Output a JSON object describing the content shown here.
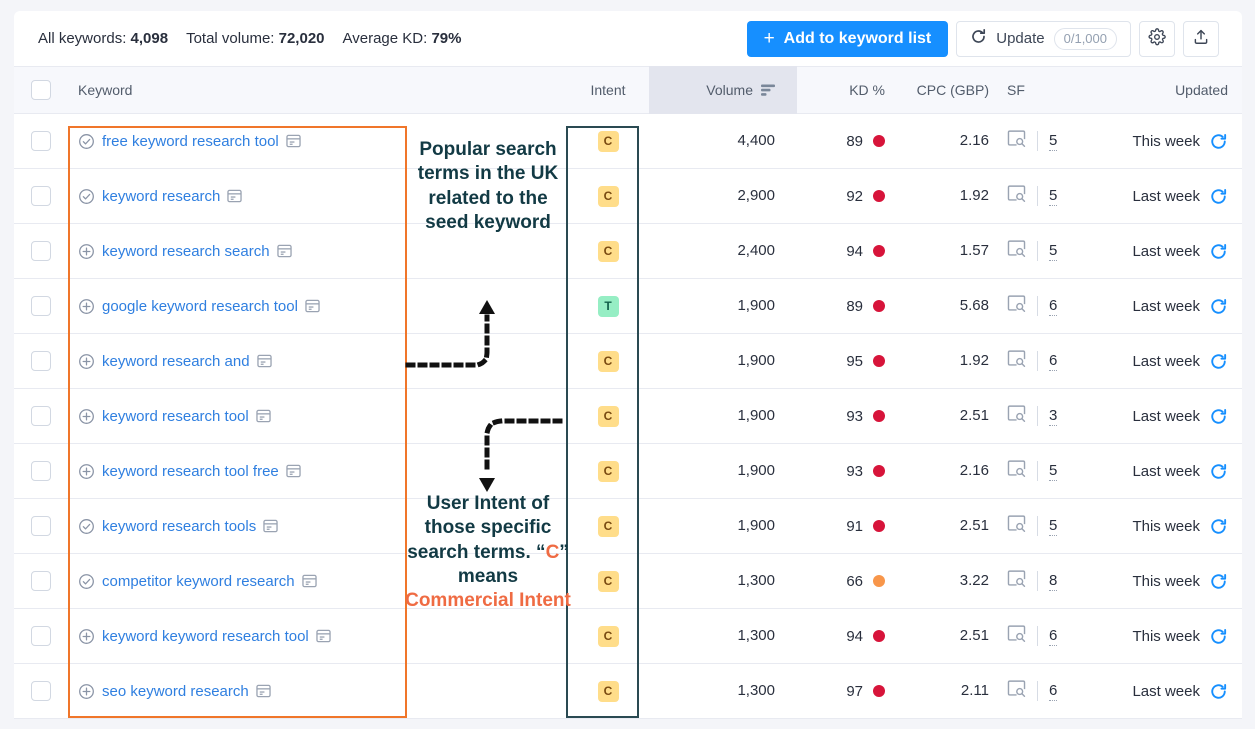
{
  "summary": {
    "all_keywords_label": "All keywords:",
    "all_keywords_value": "4,098",
    "total_volume_label": "Total volume:",
    "total_volume_value": "72,020",
    "average_kd_label": "Average KD:",
    "average_kd_value": "79%"
  },
  "toolbar": {
    "add_button_plus": "+",
    "add_button_label": "Add to keyword list",
    "update_label": "Update",
    "update_count": "0/1,000",
    "settings_icon": "gear-icon",
    "export_icon": "export-upload-icon"
  },
  "columns": {
    "keyword": "Keyword",
    "intent": "Intent",
    "volume": "Volume",
    "kd": "KD %",
    "cpc": "CPC (GBP)",
    "sf": "SF",
    "updated": "Updated"
  },
  "colors": {
    "accent_blue": "#168fff",
    "link_blue": "#2f7fe0",
    "annotation_orange": "#f0762a",
    "annotation_teal": "#123a44",
    "intent_commercial_bg": "#ffdd8a",
    "intent_transactional_bg": "#96eec4",
    "kd_high_red": "#d7143a",
    "kd_mid_orange": "#f8964a"
  },
  "rows": [
    {
      "state": "added",
      "keyword": "free keyword research tool",
      "intent": "C",
      "volume": "4,400",
      "kd": "89",
      "kd_color": "#d7143a",
      "cpc": "2.16",
      "sf": "5",
      "updated": "This week"
    },
    {
      "state": "added",
      "keyword": "keyword research",
      "intent": "C",
      "volume": "2,900",
      "kd": "92",
      "kd_color": "#d7143a",
      "cpc": "1.92",
      "sf": "5",
      "updated": "Last week"
    },
    {
      "state": "add",
      "keyword": "keyword research search",
      "intent": "C",
      "volume": "2,400",
      "kd": "94",
      "kd_color": "#d7143a",
      "cpc": "1.57",
      "sf": "5",
      "updated": "Last week"
    },
    {
      "state": "add",
      "keyword": "google keyword research tool",
      "intent": "T",
      "volume": "1,900",
      "kd": "89",
      "kd_color": "#d7143a",
      "cpc": "5.68",
      "sf": "6",
      "updated": "Last week"
    },
    {
      "state": "add",
      "keyword": "keyword research and",
      "intent": "C",
      "volume": "1,900",
      "kd": "95",
      "kd_color": "#d7143a",
      "cpc": "1.92",
      "sf": "6",
      "updated": "Last week"
    },
    {
      "state": "add",
      "keyword": "keyword research tool",
      "intent": "C",
      "volume": "1,900",
      "kd": "93",
      "kd_color": "#d7143a",
      "cpc": "2.51",
      "sf": "3",
      "updated": "Last week"
    },
    {
      "state": "add",
      "keyword": "keyword research tool free",
      "intent": "C",
      "volume": "1,900",
      "kd": "93",
      "kd_color": "#d7143a",
      "cpc": "2.16",
      "sf": "5",
      "updated": "Last week"
    },
    {
      "state": "added",
      "keyword": "keyword research tools",
      "intent": "C",
      "volume": "1,900",
      "kd": "91",
      "kd_color": "#d7143a",
      "cpc": "2.51",
      "sf": "5",
      "updated": "This week"
    },
    {
      "state": "added",
      "keyword": "competitor keyword research",
      "intent": "C",
      "volume": "1,300",
      "kd": "66",
      "kd_color": "#f8964a",
      "cpc": "3.22",
      "sf": "8",
      "updated": "This week"
    },
    {
      "state": "add",
      "keyword": "keyword keyword research tool",
      "intent": "C",
      "volume": "1,300",
      "kd": "94",
      "kd_color": "#d7143a",
      "cpc": "2.51",
      "sf": "6",
      "updated": "This week"
    },
    {
      "state": "add",
      "keyword": "seo keyword research",
      "intent": "C",
      "volume": "1,300",
      "kd": "97",
      "kd_color": "#d7143a",
      "cpc": "2.11",
      "sf": "6",
      "updated": "Last week"
    }
  ],
  "annotations": {
    "top": "Popular search terms in the UK related to the seed keyword",
    "bottom_part1": "User Intent of those specific search terms. “",
    "bottom_c": "C",
    "bottom_part2": "” means ",
    "bottom_highlight": "Commercial Intent"
  }
}
